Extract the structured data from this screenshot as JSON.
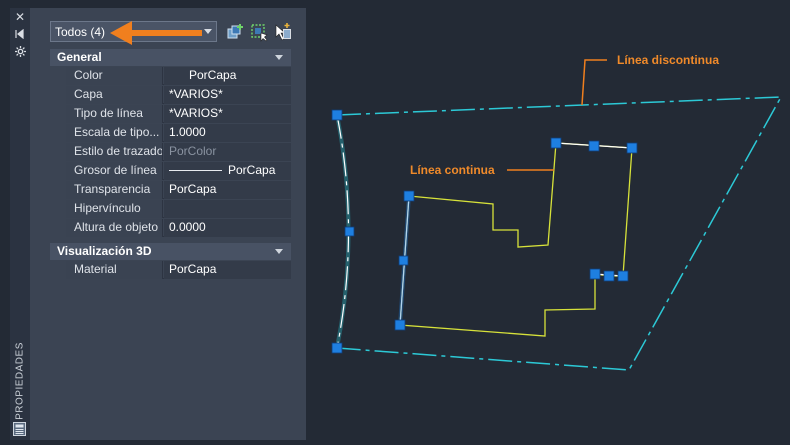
{
  "palette": {
    "title": "PROPIEDADES",
    "selection": "Todos (4)",
    "sections": [
      {
        "title": "General",
        "rows": [
          {
            "label": "Color",
            "value": "PorCapa"
          },
          {
            "label": "Capa",
            "value": "*VARIOS*"
          },
          {
            "label": "Tipo de línea",
            "value": "*VARIOS*"
          },
          {
            "label": "Escala de tipo...",
            "value": "1.0000"
          },
          {
            "label": "Estilo de trazado",
            "value": "PorColor"
          },
          {
            "label": "Grosor de línea",
            "value": "PorCapa"
          },
          {
            "label": "Transparencia",
            "value": "PorCapa"
          },
          {
            "label": "Hipervínculo",
            "value": ""
          },
          {
            "label": "Altura de objeto",
            "value": "0.0000"
          }
        ]
      },
      {
        "title": "Visualización 3D",
        "rows": [
          {
            "label": "Material",
            "value": "PorCapa"
          }
        ]
      }
    ]
  },
  "annotations": {
    "dashed": "Línea discontinua",
    "continuous": "Línea continua"
  },
  "colors": {
    "accent": "#f07f1e",
    "dashed_line": "#2cc9d6",
    "continuous_line": "#d7e23a",
    "grip": "#1e7fe0",
    "background": "#232a35"
  },
  "icons": [
    "close-icon",
    "autohide-icon",
    "settings-icon",
    "quick-select-icon",
    "select-objects-icon",
    "toggle-pickadd-icon",
    "properties-palette-icon"
  ]
}
